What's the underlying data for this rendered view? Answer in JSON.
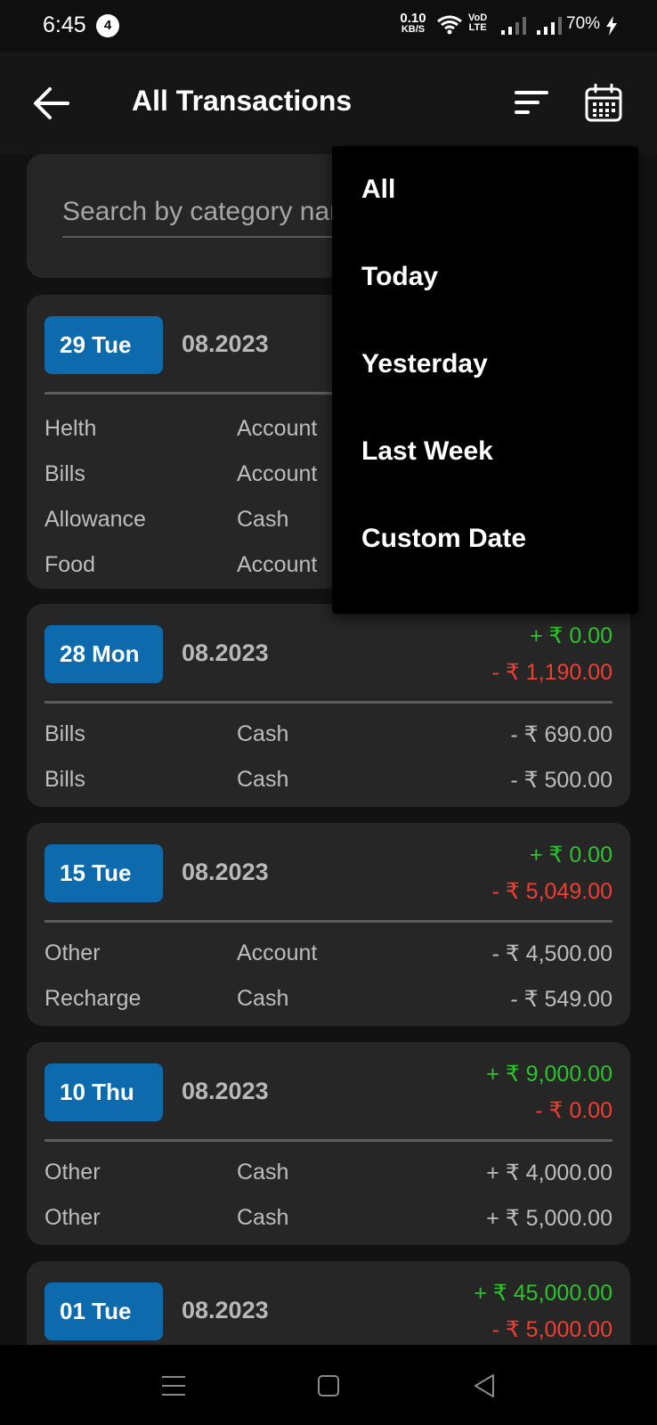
{
  "status_bar": {
    "time": "6:45",
    "notification_count": "4",
    "net_speed_value": "0.10",
    "net_speed_unit": "KB/S",
    "volte_line1": "VoD",
    "volte_line2": "LTE",
    "battery": "70%"
  },
  "header": {
    "title": "All Transactions"
  },
  "search": {
    "placeholder": "Search by category name"
  },
  "filter_menu": {
    "items": [
      {
        "label": "All"
      },
      {
        "label": "Today"
      },
      {
        "label": "Yesterday"
      },
      {
        "label": "Last Week"
      },
      {
        "label": "Custom Date"
      }
    ]
  },
  "days": [
    {
      "date": "29 Tue",
      "month_year": "08.2023",
      "income": "",
      "expense": "",
      "transactions": [
        {
          "category": "Helth",
          "account": "Account",
          "amount": ""
        },
        {
          "category": "Bills",
          "account": "Account",
          "amount": ""
        },
        {
          "category": "Allowance",
          "account": "Cash",
          "amount": ""
        },
        {
          "category": "Food",
          "account": "Account",
          "amount": ""
        }
      ]
    },
    {
      "date": "28 Mon",
      "month_year": "08.2023",
      "income": "+ ₹ 0.00",
      "expense": "- ₹ 1,190.00",
      "transactions": [
        {
          "category": "Bills",
          "account": "Cash",
          "amount": "- ₹ 690.00"
        },
        {
          "category": "Bills",
          "account": "Cash",
          "amount": "- ₹ 500.00"
        }
      ]
    },
    {
      "date": "15 Tue",
      "month_year": "08.2023",
      "income": "+ ₹ 0.00",
      "expense": "- ₹ 5,049.00",
      "transactions": [
        {
          "category": "Other",
          "account": "Account",
          "amount": "- ₹ 4,500.00"
        },
        {
          "category": "Recharge",
          "account": "Cash",
          "amount": "- ₹ 549.00"
        }
      ]
    },
    {
      "date": "10 Thu",
      "month_year": "08.2023",
      "income": "+ ₹ 9,000.00",
      "expense": "- ₹ 0.00",
      "transactions": [
        {
          "category": "Other",
          "account": "Cash",
          "amount": "+ ₹ 4,000.00"
        },
        {
          "category": "Other",
          "account": "Cash",
          "amount": "+ ₹ 5,000.00"
        }
      ]
    },
    {
      "date": "01 Tue",
      "month_year": "08.2023",
      "income": "+ ₹ 45,000.00",
      "expense": "- ₹ 5,000.00",
      "transactions": []
    }
  ],
  "colors": {
    "background": "#121212",
    "card": "#262626",
    "date_badge": "#0d6aad",
    "income": "#2ec32e",
    "expense": "#ef3e32",
    "menu_background": "#000000"
  },
  "icons": {
    "back": "arrow-left-icon",
    "sort": "sort-icon",
    "calendar": "calendar-icon",
    "nav_recent": "menu-lines-icon",
    "nav_home": "square-icon",
    "nav_back": "triangle-back-icon"
  }
}
